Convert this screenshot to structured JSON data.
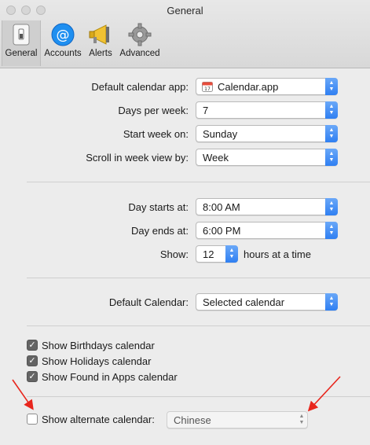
{
  "window": {
    "title": "General"
  },
  "toolbar": {
    "tabs": [
      {
        "label": "General",
        "icon": "general-switch-icon"
      },
      {
        "label": "Accounts",
        "icon": "at-sign-icon"
      },
      {
        "label": "Alerts",
        "icon": "megaphone-icon"
      },
      {
        "label": "Advanced",
        "icon": "gear-icon"
      }
    ],
    "selected": "General"
  },
  "general": {
    "default_calendar_app": {
      "label": "Default calendar app:",
      "value": "Calendar.app"
    },
    "days_per_week": {
      "label": "Days per week:",
      "value": "7"
    },
    "start_week_on": {
      "label": "Start week on:",
      "value": "Sunday"
    },
    "scroll_in_week_view_by": {
      "label": "Scroll in week view by:",
      "value": "Week"
    },
    "day_starts_at": {
      "label": "Day starts at:",
      "value": "8:00 AM"
    },
    "day_ends_at": {
      "label": "Day ends at:",
      "value": "6:00 PM"
    },
    "show": {
      "label": "Show:",
      "value": "12",
      "suffix": "hours at a time"
    },
    "default_calendar": {
      "label": "Default Calendar:",
      "value": "Selected calendar"
    },
    "checkboxes": [
      {
        "label": "Show Birthdays calendar",
        "checked": true
      },
      {
        "label": "Show Holidays calendar",
        "checked": true
      },
      {
        "label": "Show Found in Apps calendar",
        "checked": true
      }
    ],
    "alternate_calendar": {
      "label": "Show alternate calendar:",
      "checked": false,
      "value": "Chinese",
      "enabled": false
    }
  },
  "annotations": {
    "arrow_color": "#e8261d"
  },
  "colors": {
    "accent": "#2f7ff2",
    "window_bg": "#ececec"
  }
}
